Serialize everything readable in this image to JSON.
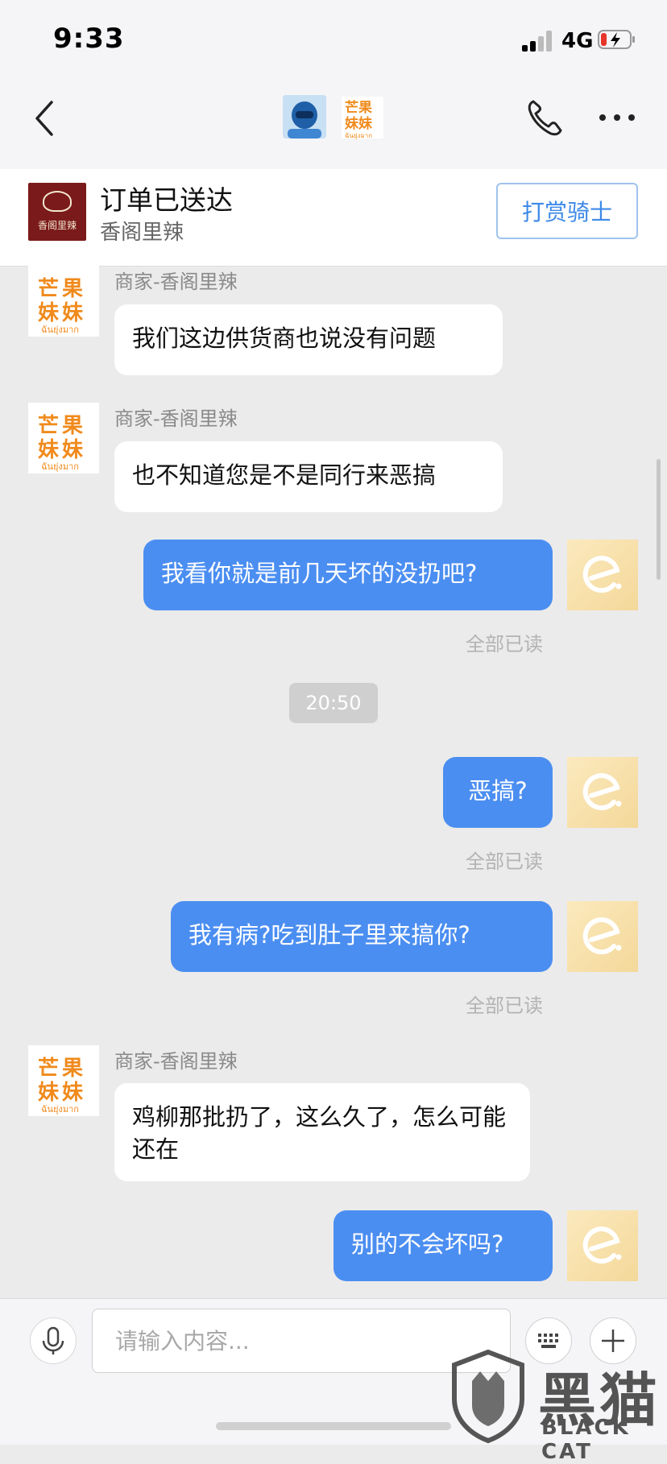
{
  "status_bar": {
    "time": "9:33",
    "network": "4G"
  },
  "header": {
    "merchant_logo_text": [
      "芒果",
      "妹妹",
      "ฉันยุ่งมาก"
    ]
  },
  "order_card": {
    "title": "订单已送达",
    "shop_name": "香阁里辣",
    "shop_logo_text": "香阁里辣",
    "tip_button": "打赏骑士"
  },
  "merchant_avatar": {
    "line1": "芒果",
    "line2": "妹妹",
    "line3": "ฉันยุ่งมาก"
  },
  "messages": [
    {
      "side": "in",
      "sender": "商家-香阁里辣",
      "text": "我们这边供货商也说没有问题"
    },
    {
      "side": "in",
      "sender": "商家-香阁里辣",
      "text": "也不知道您是不是同行来恶搞"
    },
    {
      "side": "out",
      "text": "我看你就是前几天坏的没扔吧?",
      "read": "全部已读"
    },
    {
      "side": "time",
      "text": "20:50"
    },
    {
      "side": "out",
      "text": "恶搞?",
      "read": "全部已读"
    },
    {
      "side": "out",
      "text": "我有病?吃到肚子里来搞你?",
      "read": "全部已读"
    },
    {
      "side": "in",
      "sender": "商家-香阁里辣",
      "text": "鸡柳那批扔了，这么久了，怎么可能还在"
    },
    {
      "side": "out",
      "text": "别的不会坏吗?"
    }
  ],
  "input": {
    "placeholder": "请输入内容..."
  },
  "watermark": {
    "cn": "黑猫",
    "en": "BLACK CAT"
  },
  "colors": {
    "accent_blue": "#4b8ef1",
    "background": "#ebebeb",
    "logo_orange": "#f08a1c"
  }
}
